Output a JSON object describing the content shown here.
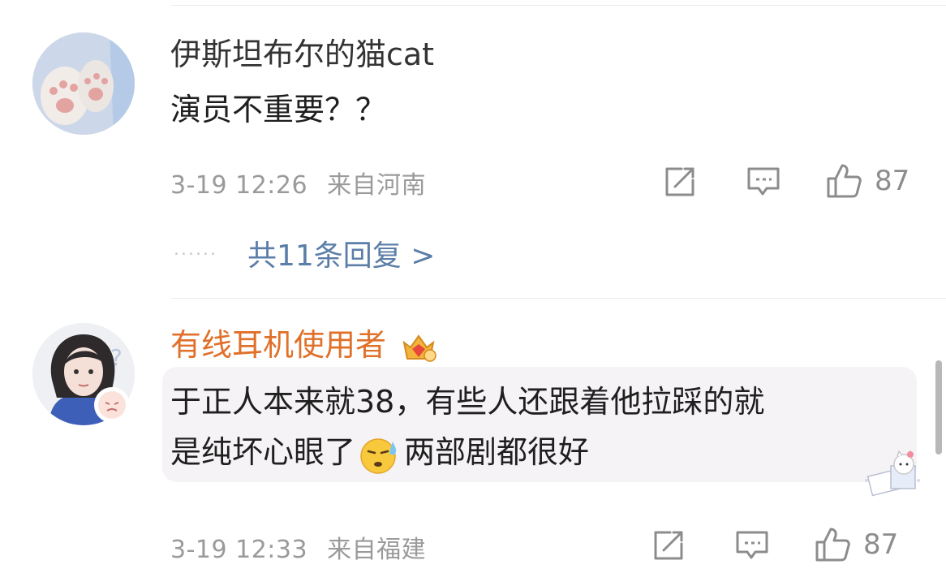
{
  "comments": [
    {
      "username": "伊斯坦布尔的猫cat",
      "content_lines": [
        "演员不重要？？"
      ],
      "timestamp": "3-19 12:26",
      "location": "来自河南",
      "likes": "87",
      "replies_label": "共11条回复 >",
      "replies_dots": "......",
      "avatar_icon": "cat-paw-avatar",
      "username_color": "#333333"
    },
    {
      "username": "有线耳机使用者",
      "content_line1": "于正人本来就38，有些人还跟着他拉踩的就",
      "content_line2_part1": "是纯坏心眼了",
      "content_line2_part2": "两部剧都很好",
      "timestamp": "3-19 12:33",
      "location": "来自福建",
      "likes": "87",
      "avatar_icon": "girl-portrait-avatar",
      "badge_icon": "crown-member-icon",
      "emoji_icon": "sweat-face-emoji",
      "username_color": "#e0702a"
    }
  ],
  "colors": {
    "reply_link": "#5b7ea8",
    "meta_text": "#9a9a9a",
    "vip_name": "#e0702a",
    "highlight_bg": "#f6f3f6"
  }
}
